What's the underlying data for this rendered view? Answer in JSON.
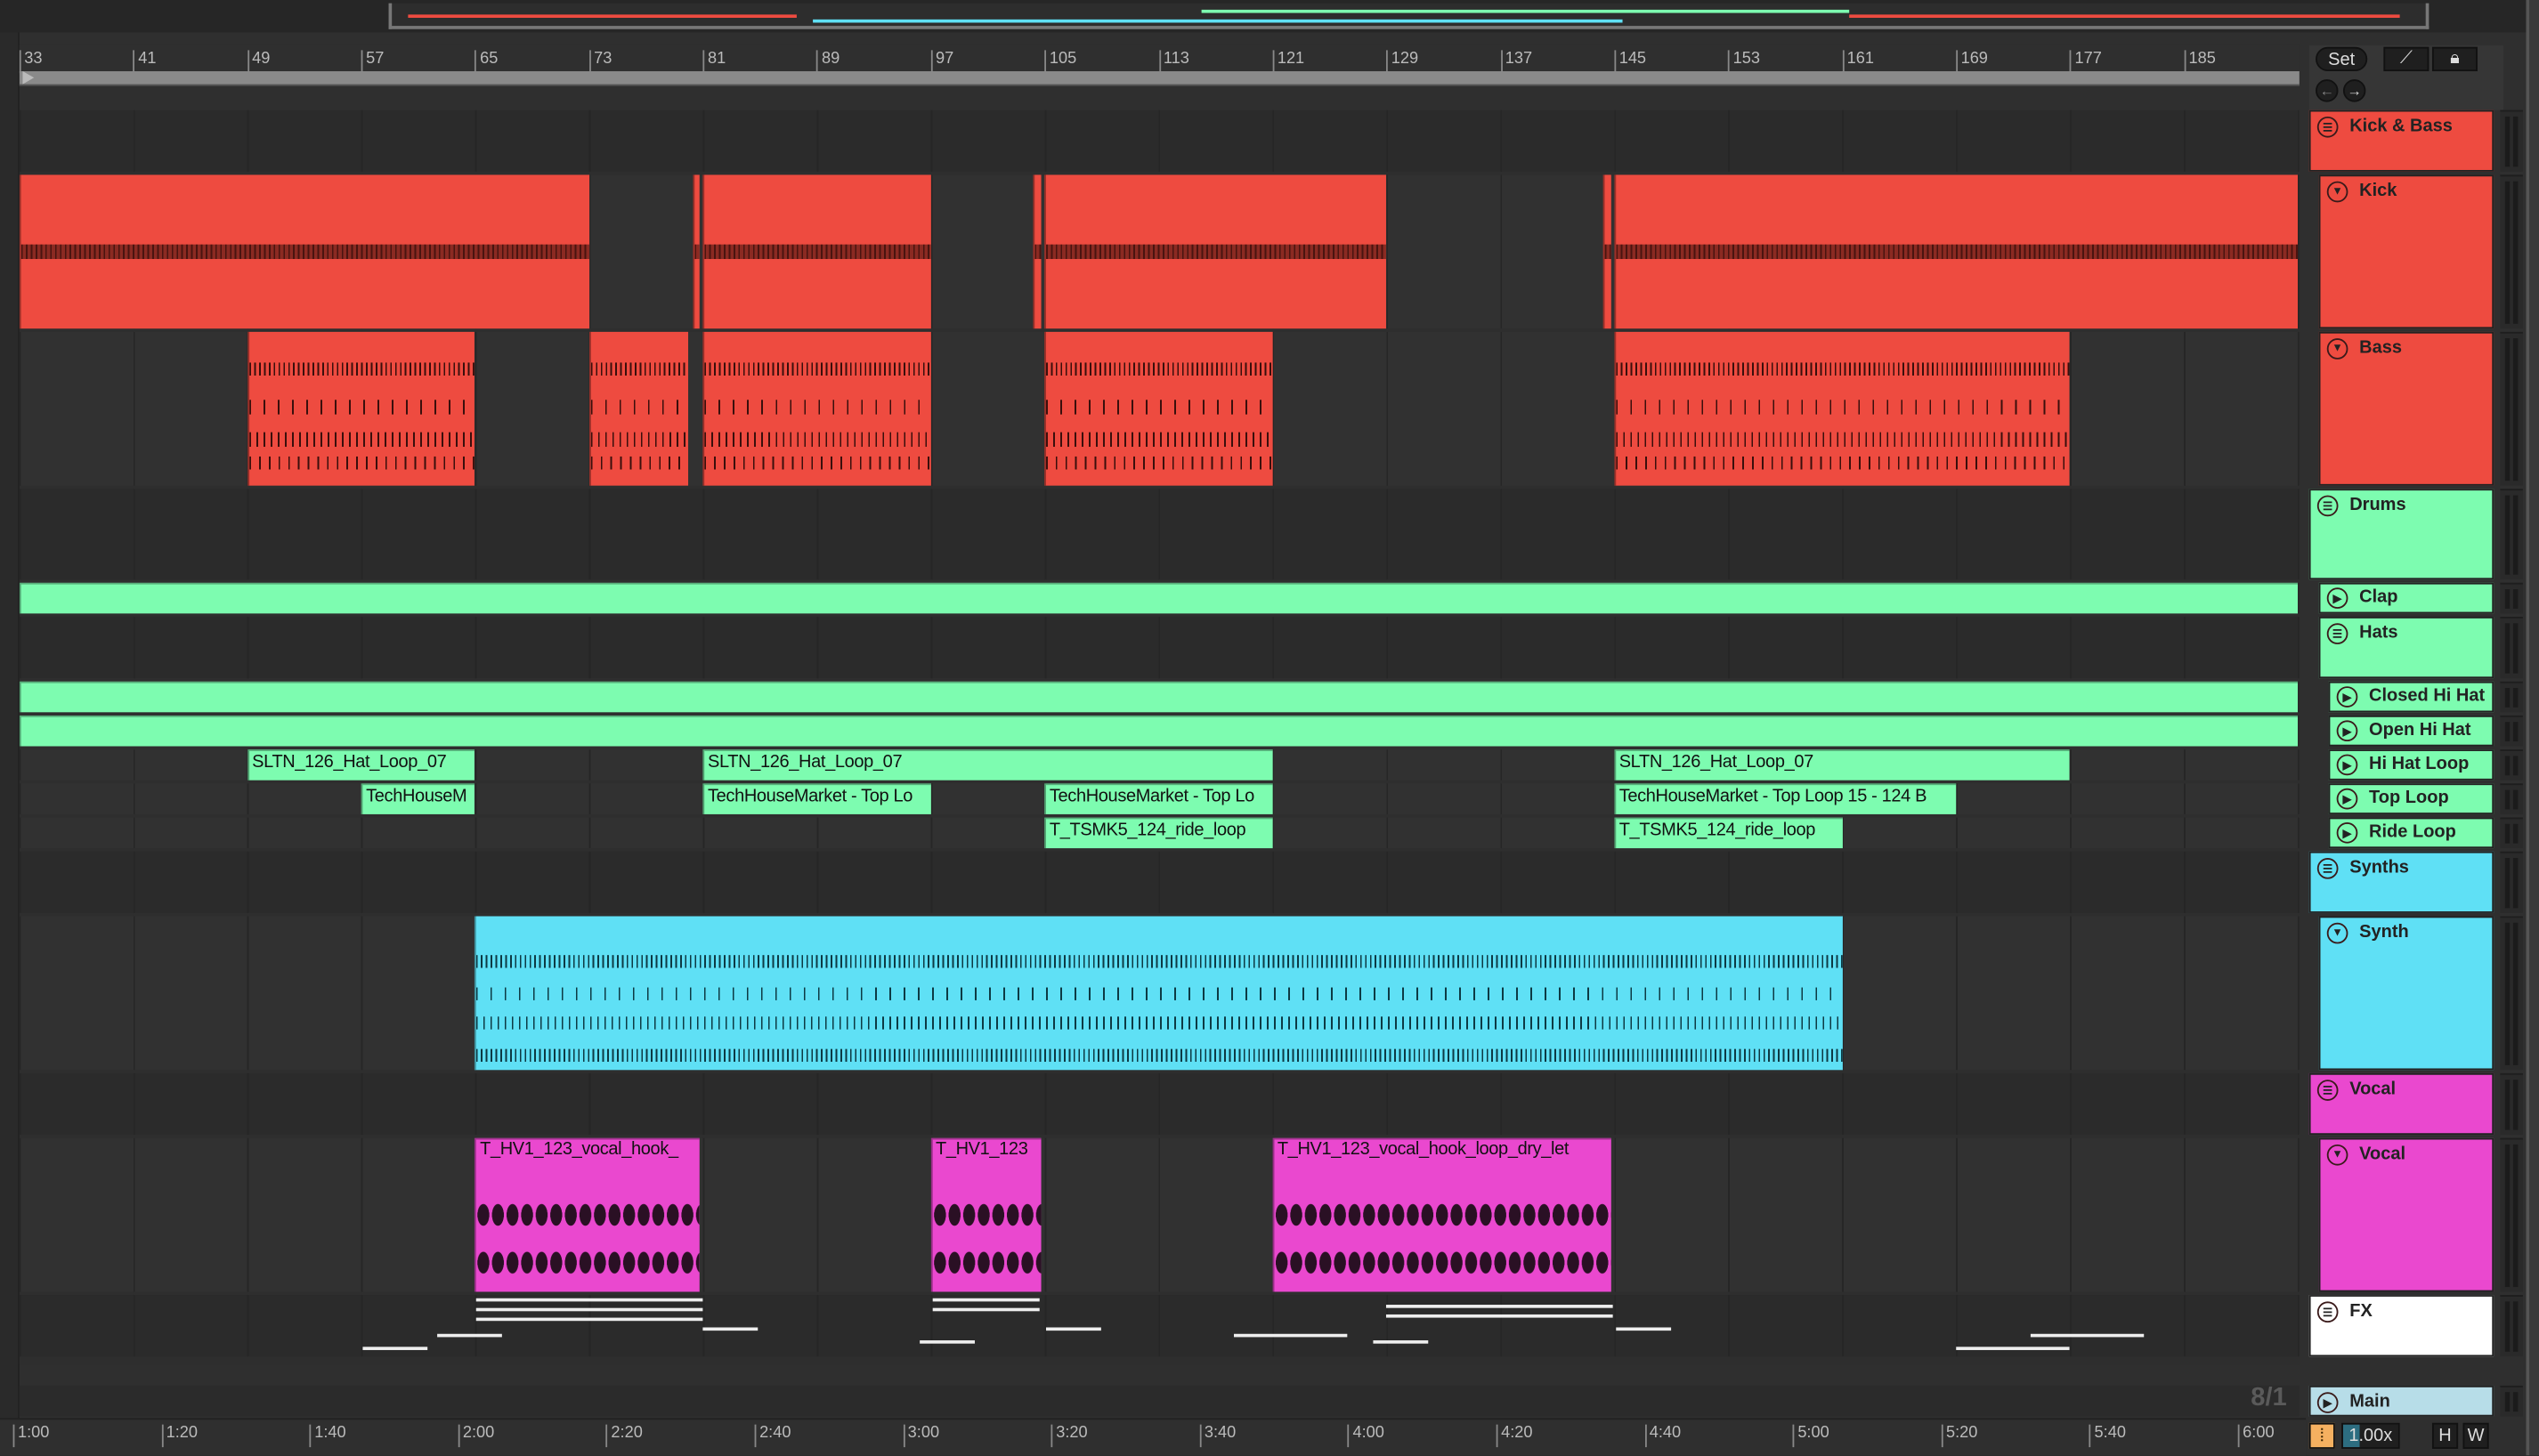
{
  "ruler": {
    "bars": [
      "33",
      "41",
      "49",
      "57",
      "65",
      "73",
      "81",
      "89",
      "97",
      "105",
      "113",
      "121",
      "129",
      "137",
      "145",
      "153",
      "161",
      "169",
      "177",
      "185"
    ],
    "first_bar": 33,
    "bars_per_label": 8
  },
  "time_ruler": {
    "labels": [
      "1:00",
      "1:20",
      "1:40",
      "2:00",
      "2:20",
      "2:40",
      "3:00",
      "3:20",
      "3:40",
      "4:00",
      "4:20",
      "4:40",
      "5:00",
      "5:20",
      "5:40",
      "6:00"
    ]
  },
  "time_signature": "8/1",
  "controls": {
    "set_label": "Set",
    "draw_icon": "pencil-icon",
    "lock_icon": "lock-icon",
    "back_icon": "arrow-left-icon",
    "forward_icon": "arrow-right-icon",
    "zoom_value": "1.00x",
    "h_label": "H",
    "w_label": "W"
  },
  "colors": {
    "red": "#ee4b40",
    "green": "#7dfcb0",
    "cyan": "#5fe0f5",
    "magenta": "#ea48cf",
    "white": "#ffffff",
    "main": "#b7dde8",
    "orange": "#f5b060"
  },
  "tracks": [
    {
      "name": "Kick & Bass",
      "kind": "group",
      "size": "group",
      "depth": 0,
      "color": "#ee4b40",
      "icon": "group-icon",
      "clips": []
    },
    {
      "name": "Kick",
      "kind": "midi",
      "size": "tall",
      "depth": 1,
      "color": "#ee4b40",
      "icon": "fold-down-icon",
      "style": "kick",
      "clips": [
        {
          "start": 33,
          "end": 73
        },
        {
          "start": 80.25,
          "end": 80.8
        },
        {
          "start": 81,
          "end": 97
        },
        {
          "start": 104.2,
          "end": 104.8
        },
        {
          "start": 105,
          "end": 129
        },
        {
          "start": 144.2,
          "end": 144.8
        },
        {
          "start": 145,
          "end": 193
        }
      ]
    },
    {
      "name": "Bass",
      "kind": "midi",
      "size": "tall",
      "depth": 1,
      "color": "#ee4b40",
      "icon": "fold-down-icon",
      "style": "bass",
      "clips": [
        {
          "start": 49,
          "end": 65
        },
        {
          "start": 73,
          "end": 80
        },
        {
          "start": 81,
          "end": 97
        },
        {
          "start": 105,
          "end": 121
        },
        {
          "start": 145,
          "end": 177
        }
      ]
    },
    {
      "name": "Drums",
      "kind": "group",
      "size": "group-tall",
      "depth": 0,
      "color": "#7dfcb0",
      "icon": "group-icon",
      "clips": []
    },
    {
      "name": "Clap",
      "kind": "audio",
      "size": "short",
      "depth": 1,
      "color": "#7dfcb0",
      "icon": "play-icon",
      "clips": [
        {
          "start": 33,
          "end": 193
        }
      ]
    },
    {
      "name": "Hats",
      "kind": "group",
      "size": "group",
      "depth": 1,
      "color": "#7dfcb0",
      "icon": "group-icon",
      "clips": []
    },
    {
      "name": "Closed Hi Hat",
      "kind": "audio",
      "size": "short",
      "depth": 2,
      "color": "#7dfcb0",
      "icon": "play-icon",
      "clips": [
        {
          "start": 33,
          "end": 193
        }
      ]
    },
    {
      "name": "Open Hi Hat",
      "kind": "audio",
      "size": "short",
      "depth": 2,
      "color": "#7dfcb0",
      "icon": "play-icon",
      "clips": [
        {
          "start": 33,
          "end": 193
        }
      ]
    },
    {
      "name": "Hi Hat Loop",
      "kind": "audio",
      "size": "short",
      "depth": 2,
      "color": "#7dfcb0",
      "icon": "play-icon",
      "clips": [
        {
          "start": 49,
          "end": 65,
          "label": "SLTN_126_Hat_Loop_07"
        },
        {
          "start": 81,
          "end": 121,
          "label": "SLTN_126_Hat_Loop_07"
        },
        {
          "start": 145,
          "end": 177,
          "label": "SLTN_126_Hat_Loop_07"
        }
      ]
    },
    {
      "name": "Top Loop",
      "kind": "audio",
      "size": "short",
      "depth": 2,
      "color": "#7dfcb0",
      "icon": "play-icon",
      "clips": [
        {
          "start": 57,
          "end": 65,
          "label": "TechHouseM"
        },
        {
          "start": 81,
          "end": 97,
          "label": "TechHouseMarket - Top Lo"
        },
        {
          "start": 105,
          "end": 121,
          "label": "TechHouseMarket - Top Lo"
        },
        {
          "start": 145,
          "end": 169,
          "label": "TechHouseMarket - Top Loop 15 - 124 B"
        }
      ]
    },
    {
      "name": "Ride Loop",
      "kind": "audio",
      "size": "short",
      "depth": 2,
      "color": "#7dfcb0",
      "icon": "play-icon",
      "clips": [
        {
          "start": 105,
          "end": 121,
          "label": "T_TSMK5_124_ride_loop"
        },
        {
          "start": 145,
          "end": 161,
          "label": "T_TSMK5_124_ride_loop"
        }
      ]
    },
    {
      "name": "Synths",
      "kind": "group",
      "size": "group",
      "depth": 0,
      "color": "#5fe0f5",
      "icon": "group-icon",
      "clips": []
    },
    {
      "name": "Synth",
      "kind": "midi",
      "size": "tall",
      "depth": 1,
      "color": "#5fe0f5",
      "icon": "fold-down-icon",
      "style": "synth",
      "clips": [
        {
          "start": 65,
          "end": 161
        }
      ]
    },
    {
      "name": "Vocal",
      "kind": "group",
      "size": "group",
      "depth": 0,
      "color": "#ea48cf",
      "icon": "group-icon",
      "clips": []
    },
    {
      "name": "Vocal",
      "kind": "audio",
      "size": "tall",
      "depth": 1,
      "color": "#ea48cf",
      "icon": "fold-down-icon",
      "style": "vocal",
      "clips": [
        {
          "start": 65,
          "end": 80.8,
          "label": "T_HV1_123_vocal_hook_"
        },
        {
          "start": 97,
          "end": 104.8,
          "label": "T_HV1_123"
        },
        {
          "start": 121,
          "end": 144.8,
          "label": "T_HV1_123_vocal_hook_loop_dry_let"
        }
      ]
    },
    {
      "name": "FX",
      "kind": "group",
      "size": "group",
      "depth": 0,
      "color": "#ffffff",
      "icon": "group-icon",
      "clips": []
    }
  ],
  "main_track": {
    "name": "Main",
    "color": "#b7dde8",
    "icon": "play-icon"
  }
}
